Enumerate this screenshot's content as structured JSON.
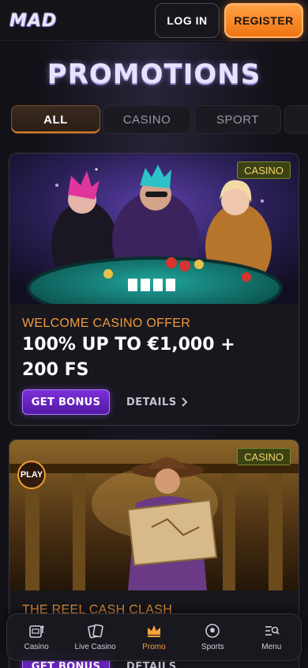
{
  "header": {
    "logo": "MAD",
    "login_label": "LOG IN",
    "register_label": "REGISTER"
  },
  "page": {
    "title": "PROMOTIONS"
  },
  "tabs": [
    {
      "label": "ALL",
      "active": true
    },
    {
      "label": "CASINO",
      "active": false
    },
    {
      "label": "SPORT",
      "active": false
    }
  ],
  "promos": [
    {
      "badge": "CASINO",
      "subtitle": "WELCOME CASINO OFFER",
      "title": "100% UP TO €1,000 + 200 FS",
      "bonus_label": "GET BONUS",
      "details_label": "DETAILS"
    },
    {
      "badge": "CASINO",
      "play_label": "PLAY",
      "subtitle": "THE REEL CASH CLASH",
      "bonus_label": "GET BONUS",
      "details_label": "DETAILS"
    }
  ],
  "bottom_nav": [
    {
      "label": "Casino",
      "icon": "slot-machine-icon",
      "active": false
    },
    {
      "label": "Live Casino",
      "icon": "cards-icon",
      "active": false
    },
    {
      "label": "Promo",
      "icon": "crown-icon",
      "active": true
    },
    {
      "label": "Sports",
      "icon": "soccer-ball-icon",
      "active": false
    },
    {
      "label": "Menu",
      "icon": "menu-search-icon",
      "active": false
    }
  ],
  "colors": {
    "accent_orange": "#f07412",
    "bonus_purple": "#7b2fd8",
    "badge_gold": "#f3d36d"
  }
}
